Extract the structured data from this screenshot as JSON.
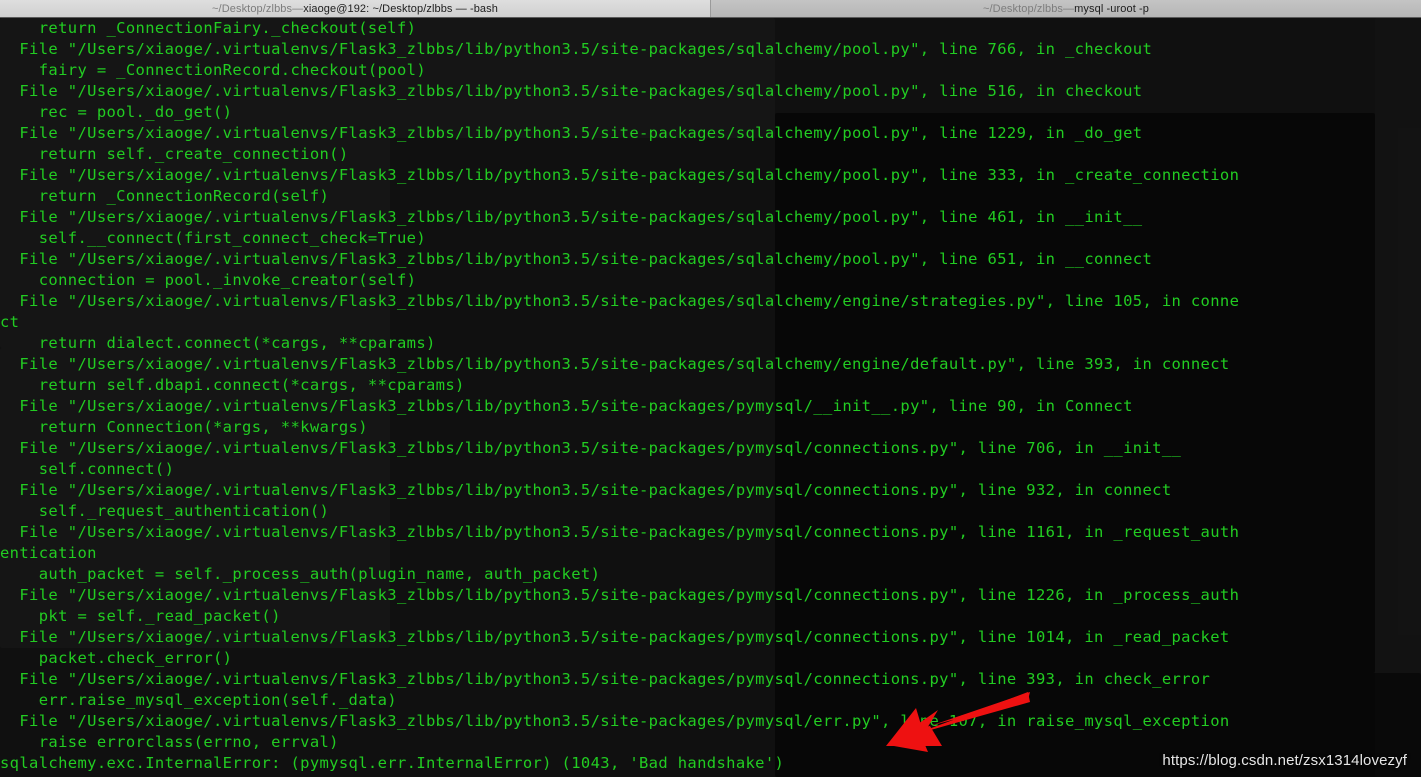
{
  "window": {
    "tabs": [
      {
        "name": "tab-bash",
        "active": true,
        "path": "~/Desktop/zlbbs",
        "separator": " — ",
        "detail": "xiaoge@192: ~/Desktop/zlbbs — -bash",
        "full_title": "~/Desktop/zlbbs — xiaoge@192: ~/Desktop/zlbbs — -bash"
      },
      {
        "name": "tab-mysql",
        "active": false,
        "path": "~/Desktop/zlbbs",
        "separator": " — ",
        "detail": "mysql -uroot -p",
        "full_title": "~/Desktop/zlbbs — mysql -uroot -p"
      }
    ]
  },
  "colors": {
    "terminal_background": "#101010",
    "terminal_foreground": "#22cc22",
    "titlebar_active": "#d3d3d3",
    "titlebar_inactive": "#bebebe",
    "arrow": "#ee1111",
    "watermark": "#e6e6e6"
  },
  "terminal": {
    "lines": [
      "    return _ConnectionFairy._checkout(self)",
      "  File \"/Users/xiaoge/.virtualenvs/Flask3_zlbbs/lib/python3.5/site-packages/sqlalchemy/pool.py\", line 766, in _checkout",
      "    fairy = _ConnectionRecord.checkout(pool)",
      "  File \"/Users/xiaoge/.virtualenvs/Flask3_zlbbs/lib/python3.5/site-packages/sqlalchemy/pool.py\", line 516, in checkout",
      "    rec = pool._do_get()",
      "  File \"/Users/xiaoge/.virtualenvs/Flask3_zlbbs/lib/python3.5/site-packages/sqlalchemy/pool.py\", line 1229, in _do_get",
      "    return self._create_connection()",
      "  File \"/Users/xiaoge/.virtualenvs/Flask3_zlbbs/lib/python3.5/site-packages/sqlalchemy/pool.py\", line 333, in _create_connection",
      "    return _ConnectionRecord(self)",
      "  File \"/Users/xiaoge/.virtualenvs/Flask3_zlbbs/lib/python3.5/site-packages/sqlalchemy/pool.py\", line 461, in __init__",
      "    self.__connect(first_connect_check=True)",
      "  File \"/Users/xiaoge/.virtualenvs/Flask3_zlbbs/lib/python3.5/site-packages/sqlalchemy/pool.py\", line 651, in __connect",
      "  File \"/Users/xiaoge/.virtualenvs/Flask3_zlbbs/lib/python3.5/site-packages/sqlalchemy/engine/strategies.py\", line 105, in conne",
      "ct",
      "    return dialect.connect(*cargs, **cparams)",
      "  File \"/Users/xiaoge/.virtualenvs/Flask3_zlbbs/lib/python3.5/site-packages/sqlalchemy/engine/default.py\", line 393, in connect",
      "    return self.dbapi.connect(*cargs, **cparams)",
      "  File \"/Users/xiaoge/.virtualenvs/Flask3_zlbbs/lib/python3.5/site-packages/pymysql/__init__.py\", line 90, in Connect",
      "    return Connection(*args, **kwargs)",
      "  File \"/Users/xiaoge/.virtualenvs/Flask3_zlbbs/lib/python3.5/site-packages/pymysql/connections.py\", line 706, in __init__",
      "    self.connect()",
      "  File \"/Users/xiaoge/.virtualenvs/Flask3_zlbbs/lib/python3.5/site-packages/pymysql/connections.py\", line 932, in connect",
      "    self._request_authentication()",
      "  File \"/Users/xiaoge/.virtualenvs/Flask3_zlbbs/lib/python3.5/site-packages/pymysql/connections.py\", line 1161, in _request_auth",
      "entication",
      "    auth_packet = self._process_auth(plugin_name, auth_packet)",
      "  File \"/Users/xiaoge/.virtualenvs/Flask3_zlbbs/lib/python3.5/site-packages/pymysql/connections.py\", line 1226, in _process_auth",
      "    pkt = self._read_packet()",
      "  File \"/Users/xiaoge/.virtualenvs/Flask3_zlbbs/lib/python3.5/site-packages/pymysql/connections.py\", line 1014, in _read_packet",
      "    packet.check_error()",
      "  File \"/Users/xiaoge/.virtualenvs/Flask3_zlbbs/lib/python3.5/site-packages/pymysql/connections.py\", line 393, in check_error",
      "    err.raise_mysql_exception(self._data)",
      "  File \"/Users/xiaoge/.virtualenvs/Flask3_zlbbs/lib/python3.5/site-packages/pymysql/err.py\", line 107, in raise_mysql_exception",
      "    raise errorclass(errno, errval)",
      "sqlalchemy.exc.InternalError: (pymysql.err.InternalError) (1043, 'Bad handshake')"
    ],
    "line_11_continuation": "    connection = pool._invoke_creator(self)",
    "error_code": "1043",
    "error_message": "Bad handshake",
    "exception_type": "sqlalchemy.exc.InternalError",
    "inner_exception_type": "pymysql.err.InternalError"
  },
  "annotation": {
    "arrow_name": "red-pointer-arrow",
    "arrow_color": "#ee1111",
    "arrow_points_to": "Bad handshake"
  },
  "watermark": {
    "text": "https://blog.csdn.net/zsx1314lovezyf"
  }
}
